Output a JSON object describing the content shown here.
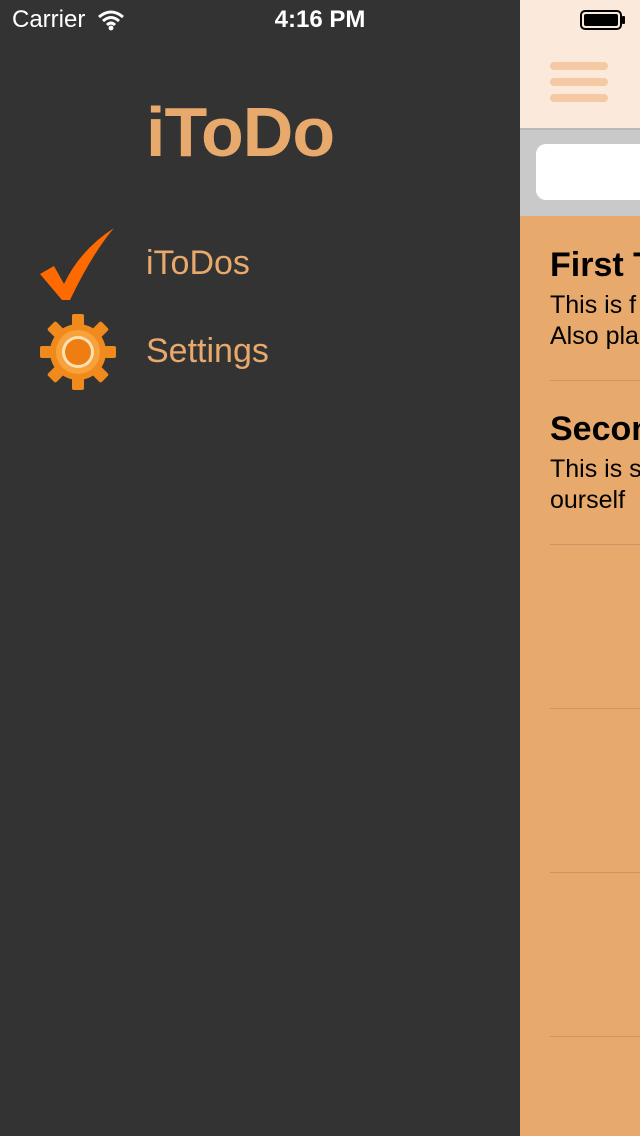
{
  "status_bar": {
    "carrier": "Carrier",
    "time": "4:16 PM"
  },
  "side_menu": {
    "title": "iToDo",
    "items": [
      {
        "label": "iToDos",
        "icon": "checkmark-icon"
      },
      {
        "label": "Settings",
        "icon": "gear-icon"
      }
    ]
  },
  "content": {
    "nav_icon": "hamburger-menu-icon",
    "rows": [
      {
        "title": "First T",
        "desc_line1": "This is f",
        "desc_line2": "Also pla"
      },
      {
        "title": "Secon",
        "desc_line1": "This is s",
        "desc_line2": "ourself"
      },
      {
        "title": "",
        "desc_line1": "",
        "desc_line2": ""
      },
      {
        "title": "",
        "desc_line1": "",
        "desc_line2": ""
      },
      {
        "title": "",
        "desc_line1": "",
        "desc_line2": ""
      },
      {
        "title": "",
        "desc_line1": "",
        "desc_line2": ""
      }
    ]
  },
  "colors": {
    "menu_background": "#333333",
    "accent_orange": "#e8a96c",
    "icon_orange": "#ff6a00",
    "nav_bar_background": "#fbeadc"
  }
}
